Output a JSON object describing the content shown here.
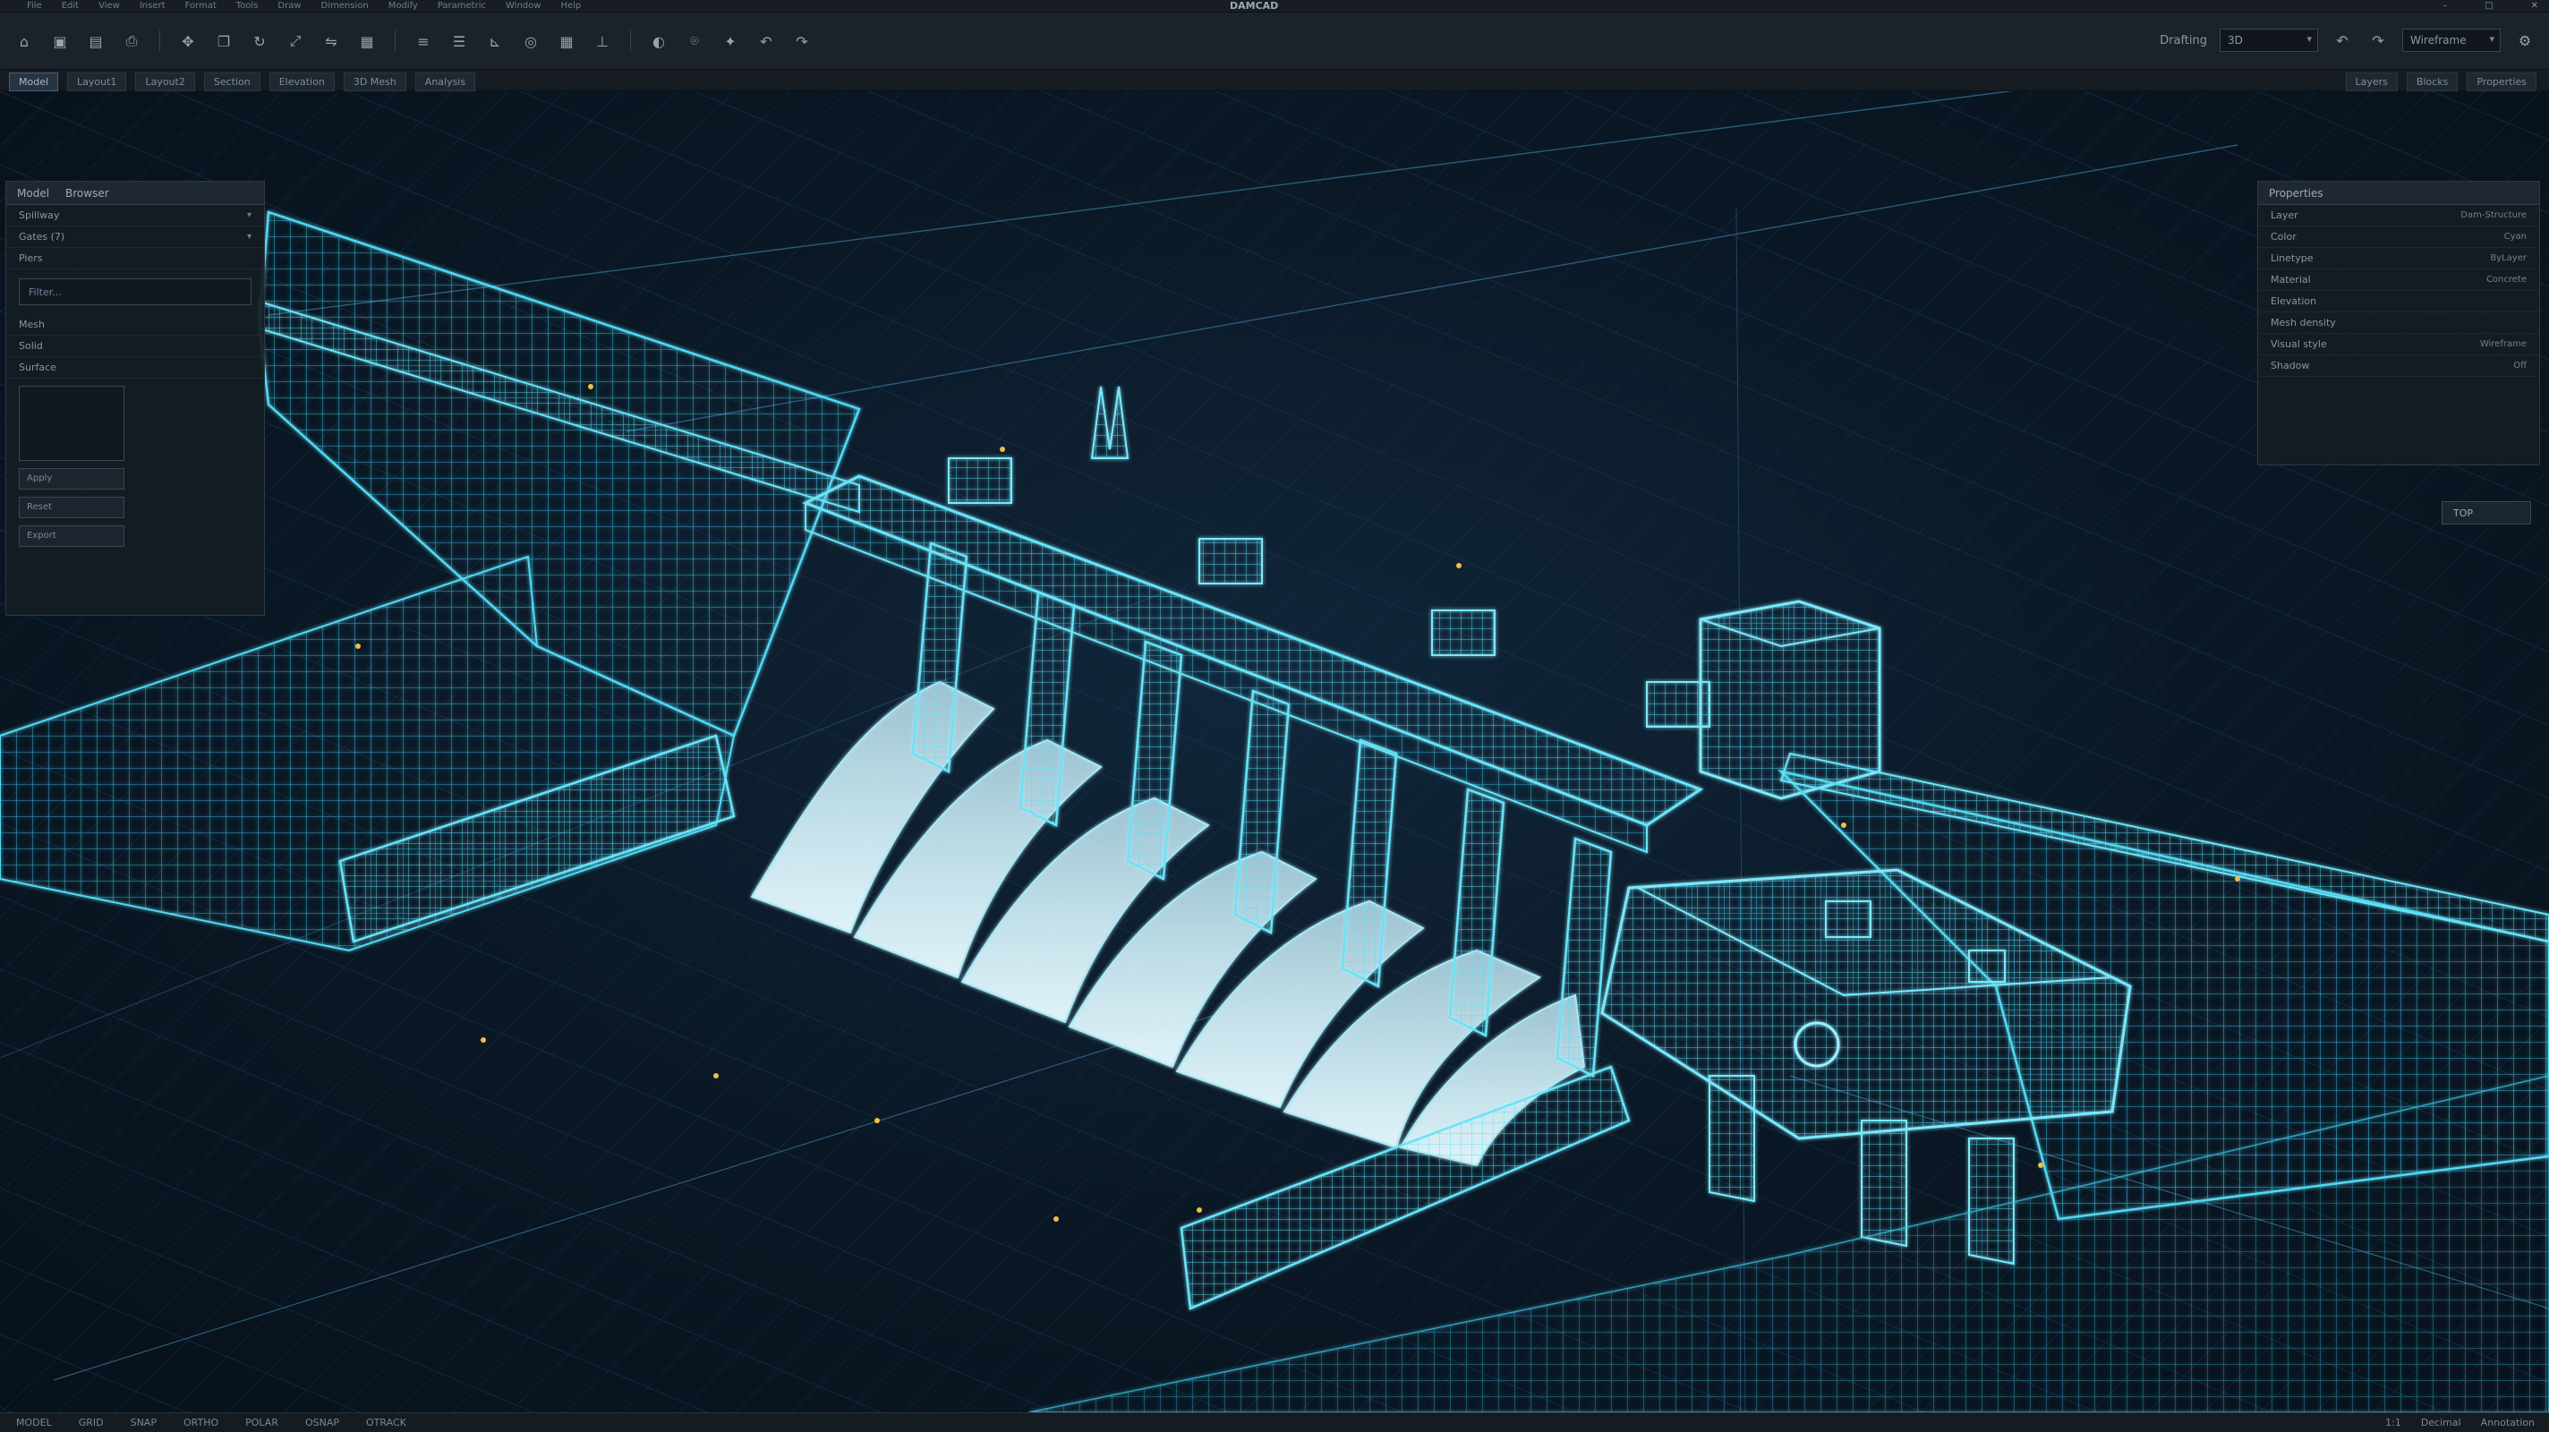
{
  "app": {
    "title": "DAMCAD"
  },
  "menu": [
    "File",
    "Edit",
    "View",
    "Insert",
    "Format",
    "Tools",
    "Draw",
    "Dimension",
    "Modify",
    "Parametric",
    "Window",
    "Help"
  ],
  "toolbar": {
    "workspace_label": "Drafting",
    "workspace_value": "3D",
    "visual_style_value": "Wireframe",
    "icons": [
      "home-icon",
      "save-icon",
      "open-icon",
      "print-icon",
      "move-icon",
      "copy-icon",
      "rotate-icon",
      "scale-icon",
      "mirror-icon",
      "array-icon",
      "layer-icon",
      "properties-icon",
      "measure-icon",
      "snap-icon",
      "grid-icon",
      "ortho-icon",
      "render-icon",
      "camera-icon",
      "light-icon",
      "undo-icon",
      "redo-icon"
    ]
  },
  "tabs": [
    "Model",
    "Layout1",
    "Layout2",
    "Section",
    "Elevation",
    "3D Mesh",
    "Analysis"
  ],
  "right_tabs": [
    "Layers",
    "Blocks",
    "Properties"
  ],
  "left_panel": {
    "header": [
      "Model",
      "Browser"
    ],
    "rows": [
      {
        "label": "Spillway",
        "value": "▾"
      },
      {
        "label": "Gates (7)",
        "value": "▾"
      },
      {
        "label": "Piers",
        "value": ""
      }
    ],
    "input_placeholder": "Filter...",
    "subrows": [
      "Mesh",
      "Solid",
      "Surface"
    ],
    "buttons": [
      "Apply",
      "Reset",
      "Export"
    ]
  },
  "right_panel": {
    "header": "Properties",
    "rows": [
      {
        "label": "Layer",
        "value": "Dam-Structure"
      },
      {
        "label": "Color",
        "value": "Cyan"
      },
      {
        "label": "Linetype",
        "value": "ByLayer"
      },
      {
        "label": "Material",
        "value": "Concrete"
      },
      {
        "label": "Elevation",
        "value": ""
      },
      {
        "label": "Mesh density",
        "value": ""
      },
      {
        "label": "Visual style",
        "value": "Wireframe"
      },
      {
        "label": "Shadow",
        "value": "Off"
      }
    ]
  },
  "viewcube_label": "TOP",
  "status": {
    "left": [
      "MODEL",
      "GRID",
      "SNAP",
      "ORTHO",
      "POLAR",
      "OSNAP",
      "OTRACK"
    ],
    "right": [
      "1:1",
      "Decimal",
      "Annotation"
    ]
  },
  "colors": {
    "wireframe": "#4fd6f0",
    "spillway_fill": "#cfeef8",
    "background": "#0a1724",
    "accent": "#f0c040"
  }
}
